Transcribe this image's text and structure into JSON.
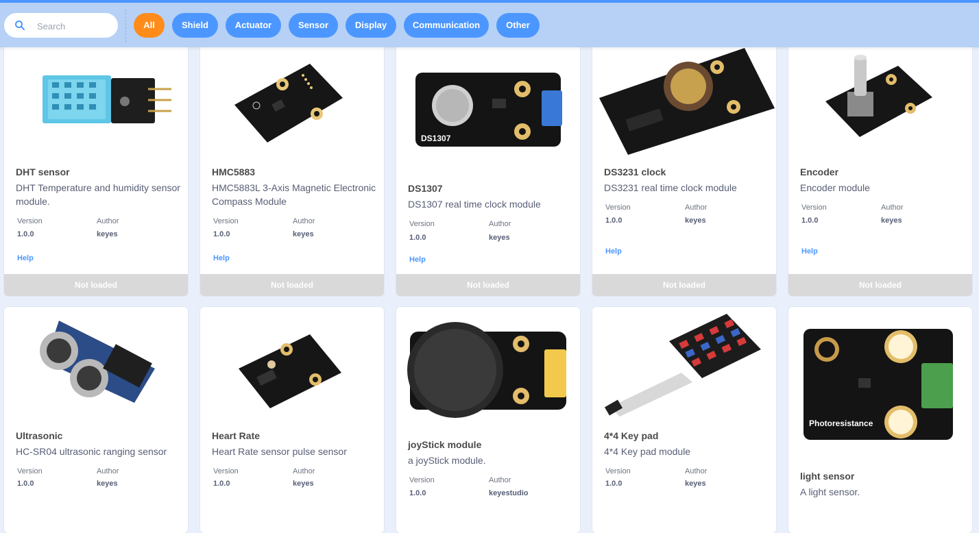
{
  "toolbar": {
    "search_placeholder": "Search",
    "filters": [
      "All",
      "Shield",
      "Actuator",
      "Sensor",
      "Display",
      "Communication",
      "Other"
    ],
    "active_filter": "All",
    "accent_color": "#4c97ff",
    "active_color": "#ff8c1a"
  },
  "labels": {
    "version": "Version",
    "author": "Author",
    "help": "Help"
  },
  "cards": [
    {
      "name": "DHT sensor",
      "desc": "DHT Temperature and humidity sensor module.",
      "version": "1.0.0",
      "author": "keyes",
      "help": "Help",
      "status": "Not loaded"
    },
    {
      "name": "HMC5883",
      "desc": "HMC5883L 3-Axis Magnetic Electronic Compass Module",
      "version": "1.0.0",
      "author": "keyes",
      "help": "Help",
      "status": "Not loaded"
    },
    {
      "name": "DS1307",
      "desc": "DS1307 real time clock module",
      "version": "1.0.0",
      "author": "keyes",
      "help": "Help",
      "status": "Not loaded",
      "img_text": "DS1307"
    },
    {
      "name": "DS3231 clock",
      "desc": "DS3231 real time clock module",
      "version": "1.0.0",
      "author": "keyes",
      "help": "Help",
      "status": "Not loaded"
    },
    {
      "name": "Encoder",
      "desc": "Encoder module",
      "version": "1.0.0",
      "author": "keyes",
      "help": "Help",
      "status": "Not loaded"
    },
    {
      "name": "Ultrasonic",
      "desc": "HC-SR04 ultrasonic ranging sensor",
      "version": "1.0.0",
      "author": "keyes"
    },
    {
      "name": "Heart Rate",
      "desc": "Heart Rate sensor pulse sensor",
      "version": "1.0.0",
      "author": "keyes"
    },
    {
      "name": "joyStick module",
      "desc": "a joyStick module.",
      "version": "1.0.0",
      "author": "keyestudio"
    },
    {
      "name": "4*4 Key pad",
      "desc": "4*4 Key pad module",
      "version": "1.0.0",
      "author": "keyes"
    },
    {
      "name": "light sensor",
      "desc": "A light sensor.",
      "img_text": "Photoresistance"
    }
  ]
}
